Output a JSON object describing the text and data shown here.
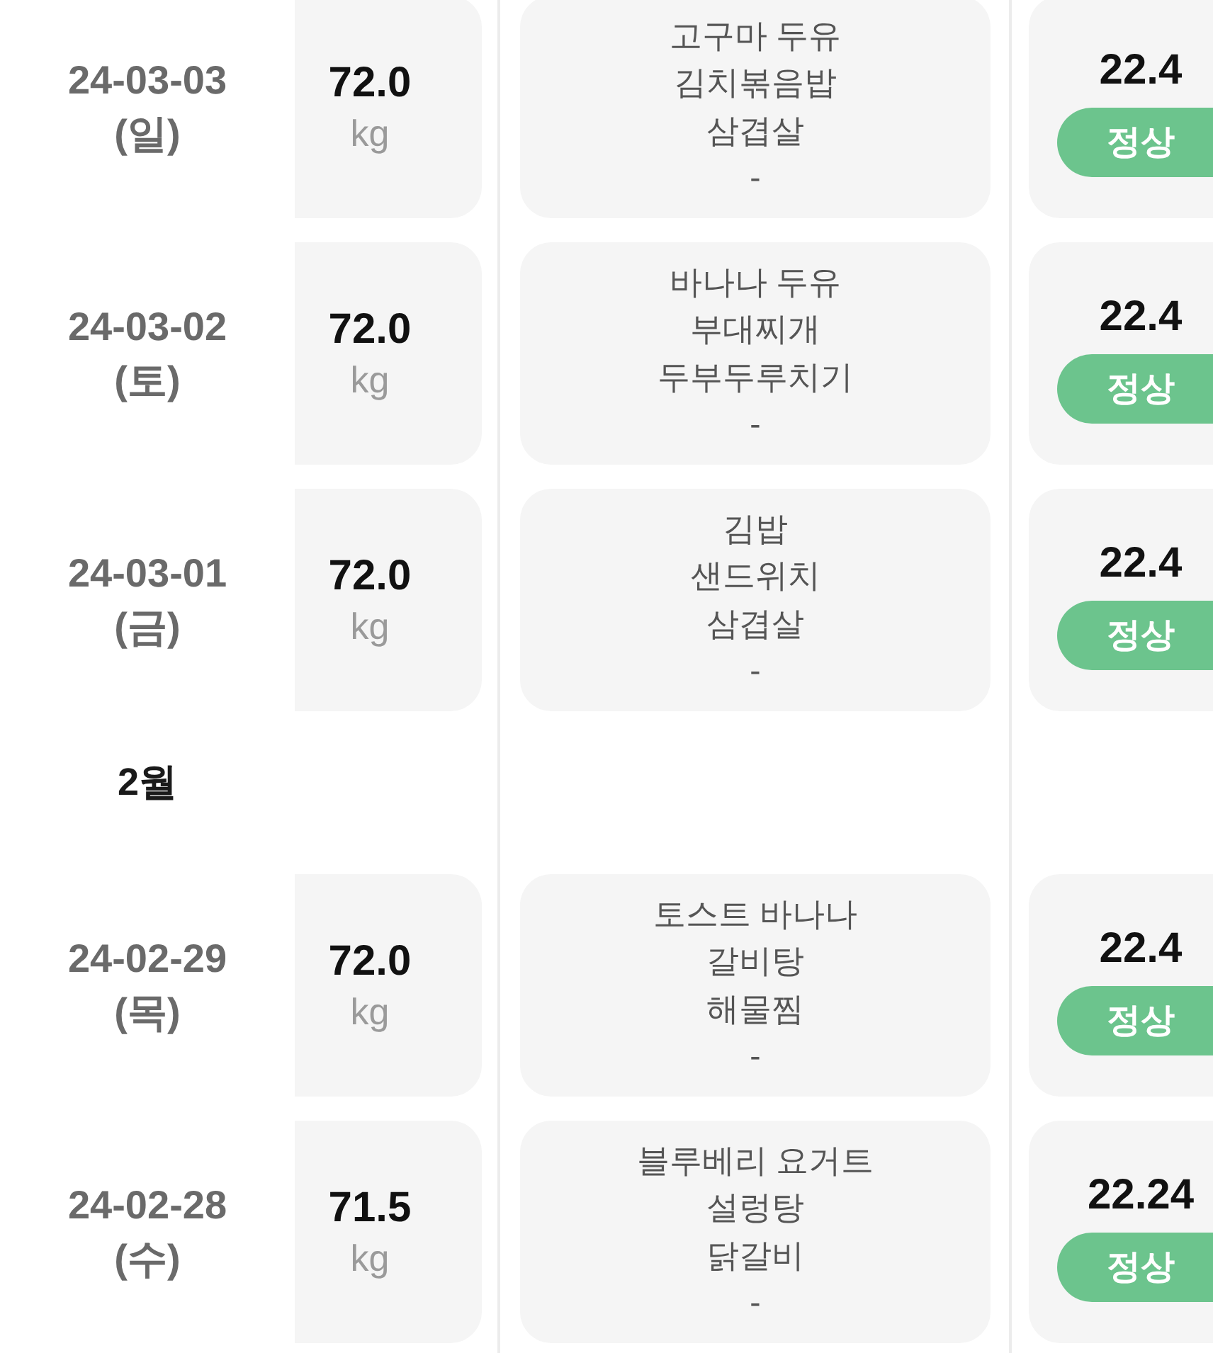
{
  "groups": [
    {
      "entries": [
        {
          "date": "24-03-03",
          "weekday": "(일)",
          "weight": "72.0",
          "unit": "kg",
          "meals": [
            "고구마 두유",
            "김치볶음밥",
            "삼겹살",
            "-"
          ],
          "bmi": "22.4",
          "status": "정상",
          "color": "#6cc48d"
        },
        {
          "date": "24-03-02",
          "weekday": "(토)",
          "weight": "72.0",
          "unit": "kg",
          "meals": [
            "바나나 두유",
            "부대찌개",
            "두부두루치기",
            "-"
          ],
          "bmi": "22.4",
          "status": "정상",
          "color": "#6cc48d"
        },
        {
          "date": "24-03-01",
          "weekday": "(금)",
          "weight": "72.0",
          "unit": "kg",
          "meals": [
            "김밥",
            "샌드위치",
            "삼겹살",
            "-"
          ],
          "bmi": "22.4",
          "status": "정상",
          "color": "#6cc48d"
        }
      ]
    },
    {
      "month": "2월",
      "entries": [
        {
          "date": "24-02-29",
          "weekday": "(목)",
          "weight": "72.0",
          "unit": "kg",
          "meals": [
            "토스트 바나나",
            "갈비탕",
            "해물찜",
            "-"
          ],
          "bmi": "22.4",
          "status": "정상",
          "color": "#6cc48d"
        },
        {
          "date": "24-02-28",
          "weekday": "(수)",
          "weight": "71.5",
          "unit": "kg",
          "meals": [
            "블루베리 요거트",
            "설렁탕",
            "닭갈비",
            "-"
          ],
          "bmi": "22.24",
          "status": "정상",
          "color": "#6cc48d"
        }
      ]
    }
  ]
}
